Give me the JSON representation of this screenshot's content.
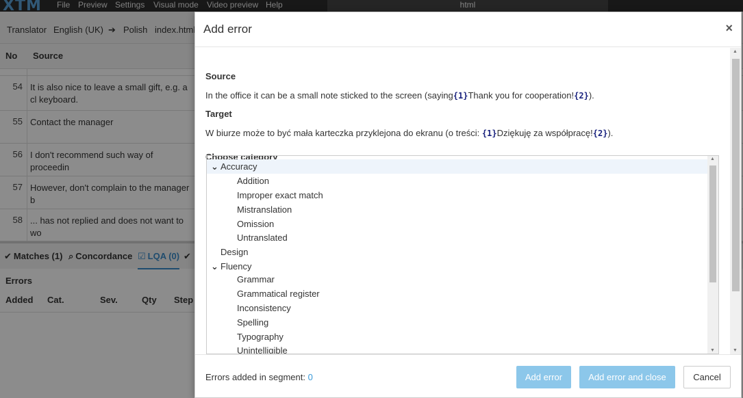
{
  "menubar": {
    "logo": "XTM",
    "items": [
      "File",
      "Preview",
      "Settings",
      "Visual mode",
      "Video preview",
      "Help"
    ],
    "title_field": "html"
  },
  "toolbar": {
    "role": "Translator",
    "source_lang": "English (UK)",
    "target_lang": "Polish",
    "file": "index.html"
  },
  "grid": {
    "headers": [
      "No",
      "Source"
    ],
    "rows": [
      {
        "no": "54",
        "source": "It is also nice to leave a small gift, e.g. a cl keyboard."
      },
      {
        "no": "55",
        "source": "Contact the manager"
      },
      {
        "no": "56",
        "source": "I don't recommend such way of proceedin"
      },
      {
        "no": "57",
        "source": "However, don't complain to the manager b"
      },
      {
        "no": "58",
        "source": "... has not replied and does not want to wo"
      }
    ]
  },
  "bottom_tabs": [
    {
      "label": "Matches (1)",
      "icon": "check-icon"
    },
    {
      "label": "Concordance",
      "icon": "search-icon"
    },
    {
      "label": "LQA (0)",
      "icon": "checkbox-icon"
    }
  ],
  "errors_panel": {
    "title": "Errors",
    "headers": [
      "Added",
      "Cat.",
      "Sev.",
      "Qty",
      "Step"
    ]
  },
  "modal": {
    "title": "Add error",
    "close_label": "×",
    "source_title": "Source",
    "source_pre": "In the office it can be a small note sticked to the screen (saying",
    "source_tag1": "{1}",
    "source_mid": "Thank you for cooperation!",
    "source_tag2": "{2}",
    "source_post": ").",
    "target_title": "Target",
    "target_pre": "W biurze może to być mała karteczka przyklejona do ekranu (o treści: ",
    "target_tag1": "{1}",
    "target_mid": "Dziękuję za współpracę!",
    "target_tag2": "{2}",
    "target_post": ").",
    "category_title": "Choose category",
    "categories": {
      "accuracy": "Accuracy",
      "accuracy_items": [
        "Addition",
        "Improper exact match",
        "Mistranslation",
        "Omission",
        "Untranslated"
      ],
      "design": "Design",
      "fluency": "Fluency",
      "fluency_items": [
        "Grammar",
        "Grammatical register",
        "Inconsistency",
        "Spelling",
        "Typography",
        "Unintelligible"
      ]
    },
    "footer": {
      "errors_added_label": "Errors added in segment:",
      "errors_added_count": "0",
      "add_error": "Add error",
      "add_error_close": "Add error and close",
      "cancel": "Cancel"
    },
    "colors": {
      "primary_button": "#8cc7ea",
      "tag": "#1a237e",
      "count": "#3a9ad9",
      "selected_row": "#eef4fb"
    }
  }
}
